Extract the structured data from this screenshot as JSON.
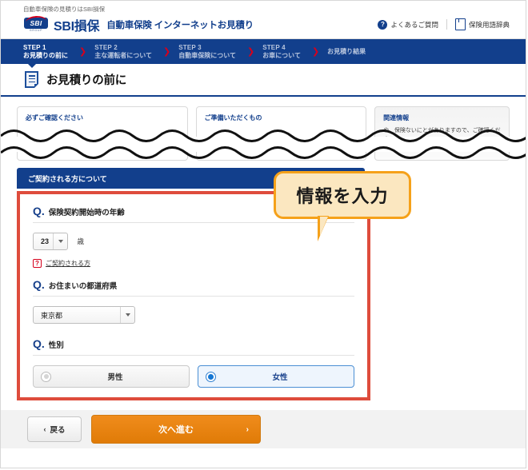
{
  "header": {
    "tagline": "自動車保険の見積りはSBI損保",
    "brand": "SBI損保",
    "brand_sub": "自動車保険 インターネットお見積り",
    "logo_text": "SBI",
    "logo_group": "GROUP",
    "links": [
      {
        "icon": "question-circle-icon",
        "label": "よくあるご質問"
      },
      {
        "icon": "book-icon",
        "label": "保険用語辞典"
      }
    ]
  },
  "steps": [
    {
      "num": "STEP 1",
      "label": "お見積りの前に",
      "active": true
    },
    {
      "num": "STEP 2",
      "label": "主な運転者について",
      "active": false
    },
    {
      "num": "STEP 3",
      "label": "自動車保険について",
      "active": false
    },
    {
      "num": "STEP 4",
      "label": "お車について",
      "active": false
    },
    {
      "num": "",
      "label": "お見積り結果",
      "active": false
    }
  ],
  "page_title": "お見積りの前に",
  "info_boxes": [
    {
      "title": "必ずご確認ください",
      "body": ""
    },
    {
      "title": "ご準備いただくもの",
      "body": ""
    },
    {
      "title": "関連情報",
      "body": "や、保険ないにとがありますので、ご確認ください。"
    }
  ],
  "section_header": "ご契約される方について",
  "callout": {
    "text": "情報を入力",
    "fill": "#FBE7C0",
    "border": "#F5A11A"
  },
  "highlight_border_color": "#DE4C3C",
  "questions": [
    {
      "mark": "Q.",
      "text": "保険契約開始時の年齢",
      "control": "select",
      "value": "23",
      "unit": "歳",
      "help": {
        "icon": "help-question-icon",
        "label": "ご契約される方"
      }
    },
    {
      "mark": "Q.",
      "text": "お住まいの都道府県",
      "control": "select",
      "value": "東京都"
    },
    {
      "mark": "Q.",
      "text": "性別",
      "control": "radio",
      "options": [
        {
          "label": "男性",
          "selected": false
        },
        {
          "label": "女性",
          "selected": true
        }
      ]
    }
  ],
  "footer": {
    "back_label": "戻る",
    "back_chevron": "‹",
    "next_label": "次へ進む",
    "next_chevron": "›"
  }
}
